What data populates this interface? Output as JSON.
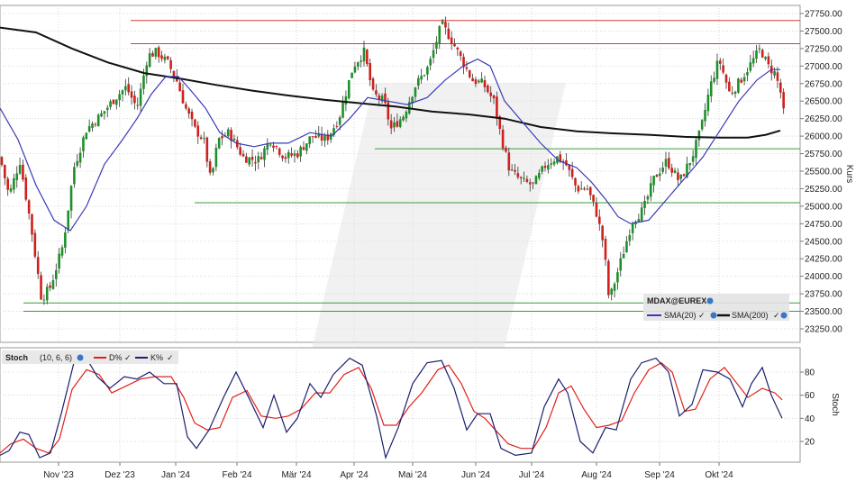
{
  "chart_data": [
    {
      "type": "candlestick",
      "instrument": "MDAX@EUREX",
      "ylabel": "Kurs",
      "ylim": [
        23250,
        27750
      ],
      "y_ticks": [
        "27750.00",
        "27500.00",
        "27250.00",
        "27000.00",
        "26750.00",
        "26500.00",
        "26250.00",
        "26000.00",
        "25750.00",
        "25500.00",
        "25250.00",
        "25000.00",
        "24750.00",
        "24500.00",
        "24250.00",
        "24000.00",
        "23750.00",
        "23500.00",
        "23250.00"
      ],
      "x_labels": [
        "Nov '23",
        "Dez '23",
        "Jan '24",
        "Feb '24",
        "Mär '24",
        "Apr '24",
        "Mai '24",
        "Jun '24",
        "Jul '24",
        "Aug '24",
        "Sep '24",
        "Okt '24"
      ],
      "legend": {
        "title": "MDAX@EUREX",
        "sma20": "SMA(20)",
        "sma200": "SMA(200)"
      },
      "resistance_levels": [
        27650,
        27320
      ],
      "support_levels": [
        25820,
        25050,
        23620,
        23500
      ],
      "close_path": [
        [
          0,
          25700
        ],
        [
          10,
          25150
        ],
        [
          22,
          25650
        ],
        [
          34,
          24750
        ],
        [
          46,
          23680
        ],
        [
          56,
          23850
        ],
        [
          70,
          24450
        ],
        [
          82,
          25550
        ],
        [
          96,
          26100
        ],
        [
          112,
          26300
        ],
        [
          128,
          26550
        ],
        [
          140,
          26700
        ],
        [
          152,
          26400
        ],
        [
          164,
          27150
        ],
        [
          174,
          27200
        ],
        [
          186,
          27050
        ],
        [
          196,
          26800
        ],
        [
          206,
          26400
        ],
        [
          216,
          26100
        ],
        [
          226,
          25950
        ],
        [
          234,
          25350
        ],
        [
          242,
          25950
        ],
        [
          254,
          26050
        ],
        [
          270,
          25700
        ],
        [
          286,
          25650
        ],
        [
          300,
          25950
        ],
        [
          316,
          25700
        ],
        [
          330,
          25750
        ],
        [
          346,
          26000
        ],
        [
          362,
          25950
        ],
        [
          376,
          26250
        ],
        [
          392,
          27000
        ],
        [
          404,
          27200
        ],
        [
          414,
          26600
        ],
        [
          426,
          26500
        ],
        [
          434,
          26100
        ],
        [
          448,
          26300
        ],
        [
          460,
          26700
        ],
        [
          476,
          27000
        ],
        [
          490,
          27600
        ],
        [
          500,
          27400
        ],
        [
          512,
          27100
        ],
        [
          524,
          26800
        ],
        [
          536,
          26750
        ],
        [
          548,
          26500
        ],
        [
          556,
          26000
        ],
        [
          566,
          25500
        ],
        [
          580,
          25350
        ],
        [
          592,
          25300
        ],
        [
          606,
          25600
        ],
        [
          618,
          25700
        ],
        [
          628,
          25600
        ],
        [
          640,
          25250
        ],
        [
          652,
          25250
        ],
        [
          662,
          24900
        ],
        [
          670,
          24450
        ],
        [
          676,
          23650
        ],
        [
          684,
          24000
        ],
        [
          692,
          24350
        ],
        [
          702,
          24800
        ],
        [
          714,
          24950
        ],
        [
          726,
          25400
        ],
        [
          740,
          25650
        ],
        [
          754,
          25350
        ],
        [
          768,
          25700
        ],
        [
          778,
          26100
        ],
        [
          788,
          26700
        ],
        [
          798,
          27100
        ],
        [
          810,
          26600
        ],
        [
          822,
          26800
        ],
        [
          834,
          27050
        ],
        [
          844,
          27250
        ],
        [
          852,
          27000
        ],
        [
          860,
          26900
        ],
        [
          866,
          26650
        ],
        [
          870,
          26300
        ]
      ],
      "sma20_path": [
        [
          0,
          26400
        ],
        [
          20,
          25950
        ],
        [
          40,
          25300
        ],
        [
          60,
          24800
        ],
        [
          78,
          24650
        ],
        [
          96,
          25000
        ],
        [
          116,
          25600
        ],
        [
          136,
          25950
        ],
        [
          152,
          26250
        ],
        [
          168,
          26600
        ],
        [
          184,
          26850
        ],
        [
          198,
          26850
        ],
        [
          212,
          26650
        ],
        [
          228,
          26400
        ],
        [
          244,
          26050
        ],
        [
          262,
          25900
        ],
        [
          282,
          25850
        ],
        [
          300,
          25900
        ],
        [
          320,
          25900
        ],
        [
          344,
          26050
        ],
        [
          368,
          26000
        ],
        [
          388,
          26250
        ],
        [
          408,
          26550
        ],
        [
          430,
          26500
        ],
        [
          452,
          26450
        ],
        [
          474,
          26550
        ],
        [
          494,
          26800
        ],
        [
          514,
          27000
        ],
        [
          530,
          27100
        ],
        [
          544,
          27000
        ],
        [
          560,
          26500
        ],
        [
          580,
          26200
        ],
        [
          600,
          25900
        ],
        [
          620,
          25650
        ],
        [
          640,
          25550
        ],
        [
          656,
          25350
        ],
        [
          672,
          25100
        ],
        [
          686,
          24850
        ],
        [
          700,
          24750
        ],
        [
          720,
          24800
        ],
        [
          740,
          25100
        ],
        [
          760,
          25400
        ],
        [
          780,
          25700
        ],
        [
          800,
          26100
        ],
        [
          820,
          26500
        ],
        [
          840,
          26800
        ],
        [
          856,
          26950
        ],
        [
          866,
          26950
        ]
      ],
      "sma200_path": [
        [
          0,
          27550
        ],
        [
          40,
          27480
        ],
        [
          80,
          27250
        ],
        [
          120,
          27050
        ],
        [
          160,
          26900
        ],
        [
          200,
          26820
        ],
        [
          240,
          26730
        ],
        [
          280,
          26650
        ],
        [
          320,
          26580
        ],
        [
          360,
          26520
        ],
        [
          400,
          26470
        ],
        [
          440,
          26420
        ],
        [
          480,
          26350
        ],
        [
          520,
          26310
        ],
        [
          560,
          26250
        ],
        [
          600,
          26130
        ],
        [
          640,
          26070
        ],
        [
          680,
          26040
        ],
        [
          720,
          26020
        ],
        [
          760,
          25990
        ],
        [
          800,
          25980
        ],
        [
          830,
          25980
        ],
        [
          850,
          26020
        ],
        [
          866,
          26080
        ]
      ]
    },
    {
      "type": "line",
      "indicator": "Stoch",
      "params": "(10, 6, 6)",
      "ylabel": "Stoch",
      "ylim": [
        0,
        100
      ],
      "y_ticks": [
        "80",
        "60",
        "40",
        "20"
      ],
      "series": [
        {
          "name": "D%",
          "color": "#e0201c",
          "path": [
            [
              0,
              10
            ],
            [
              12,
              18
            ],
            [
              26,
              22
            ],
            [
              40,
              14
            ],
            [
              54,
              10
            ],
            [
              66,
              22
            ],
            [
              80,
              65
            ],
            [
              96,
              82
            ],
            [
              110,
              78
            ],
            [
              124,
              62
            ],
            [
              140,
              68
            ],
            [
              156,
              74
            ],
            [
              172,
              76
            ],
            [
              190,
              76
            ],
            [
              204,
              58
            ],
            [
              216,
              36
            ],
            [
              230,
              30
            ],
            [
              244,
              32
            ],
            [
              258,
              58
            ],
            [
              274,
              64
            ],
            [
              290,
              42
            ],
            [
              306,
              40
            ],
            [
              320,
              42
            ],
            [
              334,
              48
            ],
            [
              350,
              62
            ],
            [
              366,
              62
            ],
            [
              382,
              78
            ],
            [
              398,
              84
            ],
            [
              412,
              66
            ],
            [
              426,
              34
            ],
            [
              440,
              34
            ],
            [
              454,
              50
            ],
            [
              468,
              62
            ],
            [
              486,
              82
            ],
            [
              498,
              86
            ],
            [
              512,
              70
            ],
            [
              526,
              46
            ],
            [
              538,
              40
            ],
            [
              552,
              28
            ],
            [
              564,
              18
            ],
            [
              578,
              14
            ],
            [
              592,
              14
            ],
            [
              606,
              32
            ],
            [
              620,
              62
            ],
            [
              634,
              68
            ],
            [
              648,
              48
            ],
            [
              662,
              32
            ],
            [
              676,
              34
            ],
            [
              690,
              38
            ],
            [
              704,
              62
            ],
            [
              720,
              82
            ],
            [
              734,
              88
            ],
            [
              746,
              80
            ],
            [
              760,
              46
            ],
            [
              772,
              48
            ],
            [
              788,
              74
            ],
            [
              804,
              84
            ],
            [
              818,
              70
            ],
            [
              830,
              58
            ],
            [
              846,
              66
            ],
            [
              860,
              62
            ],
            [
              868,
              56
            ]
          ]
        },
        {
          "name": "K%",
          "color": "#1a1f6e",
          "path": [
            [
              0,
              8
            ],
            [
              10,
              12
            ],
            [
              22,
              28
            ],
            [
              32,
              26
            ],
            [
              44,
              6
            ],
            [
              56,
              10
            ],
            [
              68,
              44
            ],
            [
              82,
              88
            ],
            [
              96,
              92
            ],
            [
              108,
              76
            ],
            [
              122,
              66
            ],
            [
              138,
              76
            ],
            [
              152,
              74
            ],
            [
              166,
              80
            ],
            [
              182,
              70
            ],
            [
              196,
              70
            ],
            [
              208,
              24
            ],
            [
              218,
              14
            ],
            [
              232,
              30
            ],
            [
              248,
              58
            ],
            [
              262,
              80
            ],
            [
              276,
              58
            ],
            [
              292,
              32
            ],
            [
              304,
              60
            ],
            [
              318,
              28
            ],
            [
              330,
              40
            ],
            [
              344,
              70
            ],
            [
              356,
              58
            ],
            [
              370,
              78
            ],
            [
              388,
              92
            ],
            [
              402,
              86
            ],
            [
              418,
              42
            ],
            [
              428,
              6
            ],
            [
              442,
              32
            ],
            [
              458,
              70
            ],
            [
              474,
              88
            ],
            [
              490,
              90
            ],
            [
              504,
              66
            ],
            [
              518,
              30
            ],
            [
              530,
              44
            ],
            [
              544,
              44
            ],
            [
              556,
              14
            ],
            [
              572,
              8
            ],
            [
              590,
              10
            ],
            [
              604,
              50
            ],
            [
              620,
              74
            ],
            [
              630,
              62
            ],
            [
              644,
              20
            ],
            [
              658,
              10
            ],
            [
              672,
              32
            ],
            [
              684,
              30
            ],
            [
              700,
              74
            ],
            [
              712,
              88
            ],
            [
              728,
              92
            ],
            [
              742,
              80
            ],
            [
              754,
              42
            ],
            [
              768,
              52
            ],
            [
              780,
              82
            ],
            [
              796,
              80
            ],
            [
              810,
              74
            ],
            [
              824,
              50
            ],
            [
              834,
              70
            ],
            [
              846,
              84
            ],
            [
              856,
              60
            ],
            [
              868,
              40
            ]
          ]
        }
      ]
    }
  ]
}
